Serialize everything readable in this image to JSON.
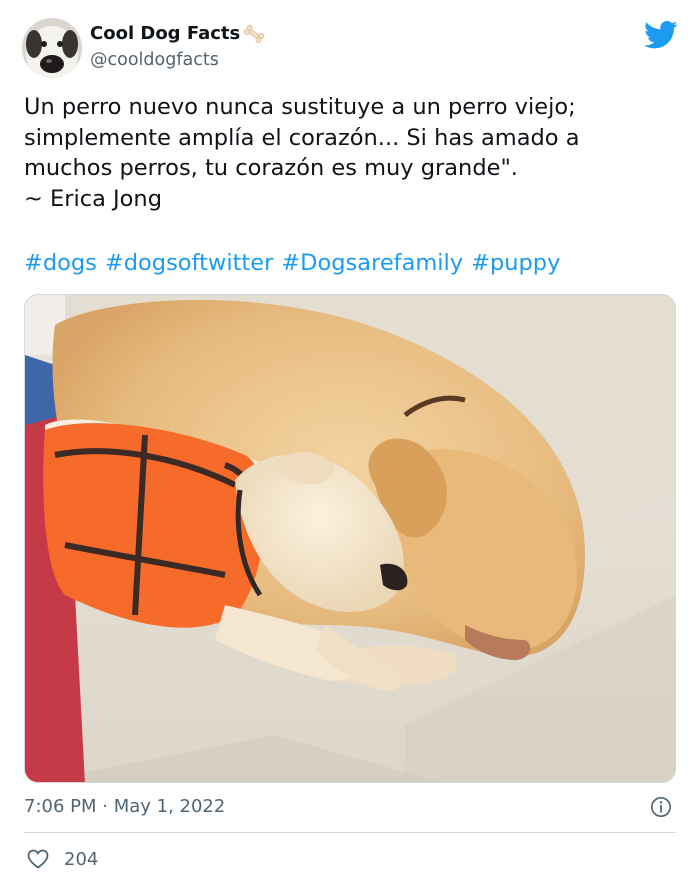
{
  "user": {
    "display_name": "Cool Dog Facts",
    "handle": "@cooldogfacts",
    "name_emoji": "bone-icon",
    "avatar": "dog-avatar"
  },
  "platform_icon": "twitter-bird-icon",
  "tweet": {
    "text": "Un perro nuevo nunca sustituye a un perro viejo;\nsimplemente amplía el corazón... Si has amado a\nmuchos perros, tu corazón es muy grande\".\n~ Erica Jong",
    "hashtags": [
      "#dogs",
      "#dogsoftwitter",
      "#Dogsarefamily",
      "#puppy"
    ],
    "photo": "photo-puppy-and-dog-sleeping",
    "timestamp": "7:06 PM · May 1, 2022",
    "likes": "204"
  },
  "colors": {
    "accent": "#1d9bf0",
    "text": "#0f1419",
    "secondary": "#536471",
    "border": "#cfd9de"
  }
}
